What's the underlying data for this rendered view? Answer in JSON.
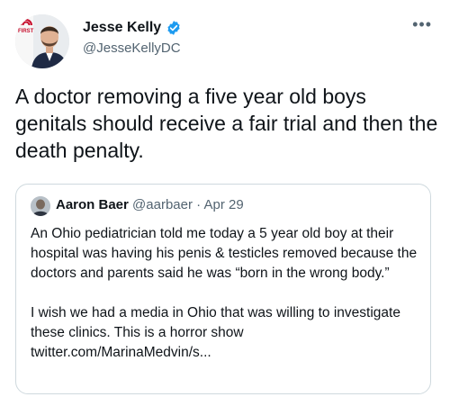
{
  "tweet": {
    "author": {
      "display_name": "Jesse Kelly",
      "handle": "@JesseKellyDC",
      "avatar_badge": "FIRST",
      "verified": true
    },
    "more_label": "•••",
    "text": "A doctor removing a five year old boys genitals should receive a fair trial and then the death penalty."
  },
  "quoted_tweet": {
    "author": {
      "display_name": "Aaron Baer",
      "handle": "@aarbaer",
      "separator": "·",
      "date": "Apr 29"
    },
    "paragraphs": [
      "An Ohio pediatrician told me today a 5 year old boy at their hospital was having his penis & testicles removed because the doctors and parents said he was “born in the wrong body.”",
      "I wish we had a media in Ohio that was willing to investigate these clinics. This is a horror show twitter.com/MarinaMedvin/s..."
    ]
  },
  "colors": {
    "text_primary": "#0f1419",
    "text_secondary": "#536471",
    "verified_blue": "#1d9bf0",
    "border": "#cfd9de",
    "badge_red": "#c8102e"
  },
  "icons": [
    "verified-badge-icon",
    "more-options-icon"
  ]
}
